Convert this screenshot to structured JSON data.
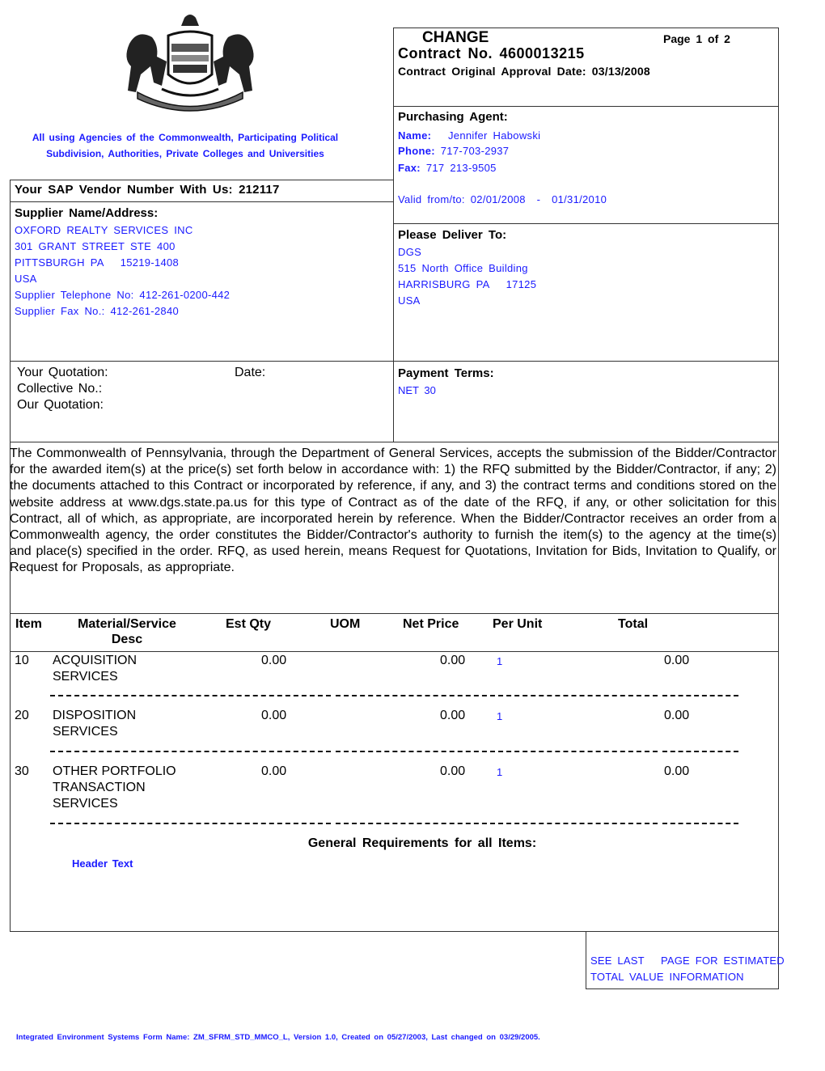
{
  "header": {
    "agencies_line1": "All using Agencies of the Commonwealth, Participating Political",
    "agencies_line2": "Subdivision, Authorities, Private Colleges and Universities",
    "doc_type": "CHANGE",
    "page_info": "Page 1 of 2",
    "contract_no": "Contract No. 4600013215",
    "approval_date": "Contract Original Approval Date: 03/13/2008"
  },
  "purchasing_agent": {
    "title": "Purchasing Agent:",
    "name_label": "Name:",
    "name": "Jennifer Habowski",
    "phone_label": "Phone:",
    "phone": "717-703-2937",
    "fax_label": "Fax:",
    "fax": "717 213-9505",
    "valid": "Valid from/to: 02/01/2008  -  01/31/2010"
  },
  "vendor": {
    "vendor_number_line": "Your SAP Vendor Number With Us: 212117",
    "supplier_title": "Supplier Name/Address:",
    "lines": [
      "OXFORD REALTY SERVICES INC",
      "301 GRANT STREET STE 400",
      "PITTSBURGH PA   15219-1408",
      "USA",
      "Supplier Telephone No: 412-261-0200-442",
      "Supplier Fax No.: 412-261-2840"
    ]
  },
  "deliver_to": {
    "title": "Please Deliver To:",
    "lines": [
      "DGS",
      "515 North Office Building",
      "HARRISBURG PA   17125",
      "USA"
    ]
  },
  "quotation": {
    "your_quotation": "Your Quotation:",
    "date": "Date:",
    "collective_no": "Collective No.:",
    "our_quotation": "Our Quotation:"
  },
  "payment_terms": {
    "title": "Payment Terms:",
    "value": "NET 30"
  },
  "terms_paragraph": "The Commonwealth of Pennsylvania, through the Department of General Services, accepts the submission of the Bidder/Contractor for the awarded item(s) at the price(s) set forth below in accordance with: 1) the RFQ submitted by the Bidder/Contractor, if any; 2) the documents attached to this Contract or incorporated by reference, if any, and 3) the contract terms and conditions stored on the website address at www.dgs.state.pa.us for this type of Contract as of the date of the RFQ, if any, or other solicitation for this Contract, all of which, as appropriate, are incorporated herein by reference. When the Bidder/Contractor receives an order from a Commonwealth agency, the order constitutes the Bidder/Contractor's authority to furnish the item(s) to the agency at the time(s) and place(s) specified in the order. RFQ, as used herein, means Request for Quotations, Invitation for Bids, Invitation to Qualify, or Request for Proposals, as appropriate.",
  "items_table": {
    "columns": {
      "item": "Item",
      "desc_line1": "Material/Service",
      "desc_line2": "Desc",
      "est_qty": "Est Qty",
      "uom": "UOM",
      "net_price": "Net Price",
      "per_unit": "Per Unit",
      "total": "Total"
    },
    "rows": [
      {
        "item": "10",
        "desc": [
          "ACQUISITION",
          "SERVICES"
        ],
        "est_qty": "0.00",
        "uom": "",
        "net_price": "0.00",
        "per_unit": "1",
        "total": "0.00"
      },
      {
        "item": "20",
        "desc": [
          "DISPOSITION",
          "SERVICES"
        ],
        "est_qty": "0.00",
        "uom": "",
        "net_price": "0.00",
        "per_unit": "1",
        "total": "0.00"
      },
      {
        "item": "30",
        "desc": [
          "OTHER PORTFOLIO",
          "TRANSACTION",
          "SERVICES"
        ],
        "est_qty": "0.00",
        "uom": "",
        "net_price": "0.00",
        "per_unit": "1",
        "total": "0.00"
      }
    ],
    "general_requirements": "General Requirements for all Items:",
    "header_text": "Header Text"
  },
  "estimated_total_note": {
    "line1": "SEE LAST   PAGE FOR ESTIMATED",
    "line2": "TOTAL VALUE INFORMATION"
  },
  "footer": "Integrated Environment Systems Form Name: ZM_SFRM_STD_MMCO_L, Version 1.0, Created on 05/27/2003, Last changed on 03/29/2005.",
  "colors": {
    "text_blue": "#1a1aff",
    "border": "#333333"
  }
}
